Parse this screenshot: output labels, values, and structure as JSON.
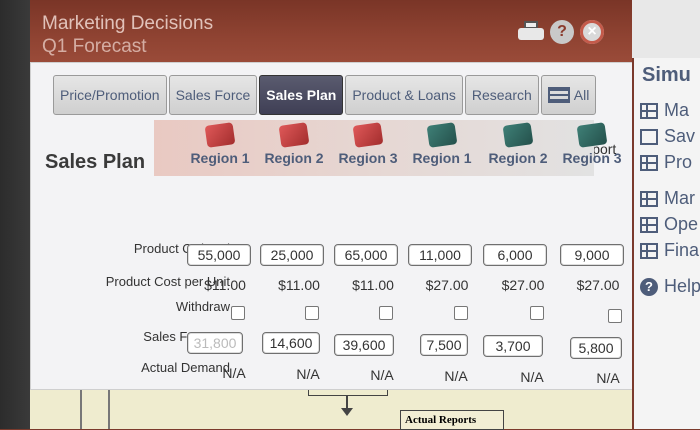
{
  "app": {
    "title": "Marketing Decisions",
    "subtitle": "Q1 Forecast"
  },
  "top_icons": {
    "help": "?",
    "close": "×"
  },
  "tabs": [
    {
      "label": "Price/Promotion",
      "active": false
    },
    {
      "label": "Sales Force",
      "active": false
    },
    {
      "label": "Sales Plan",
      "active": true
    },
    {
      "label": "Product & Loans",
      "active": false
    },
    {
      "label": "Research",
      "active": false
    },
    {
      "label": "All",
      "active": false
    }
  ],
  "page": {
    "title": "Sales Plan",
    "mrkt_report": "MRKT Report"
  },
  "regions": [
    {
      "label": "Region 1",
      "product": "red"
    },
    {
      "label": "Region 2",
      "product": "red"
    },
    {
      "label": "Region 3",
      "product": "red"
    },
    {
      "label": "Region 1",
      "product": "green"
    },
    {
      "label": "Region 2",
      "product": "green"
    },
    {
      "label": "Region 3",
      "product": "green"
    }
  ],
  "rows": {
    "product_ordered": {
      "label": "Product Ordered",
      "values": [
        "55,000",
        "25,000",
        "65,000",
        "11,000",
        "6,000",
        "9,000"
      ]
    },
    "product_cost": {
      "label": "Product Cost per Unit",
      "values": [
        "$11.00",
        "$11.00",
        "$11.00",
        "$27.00",
        "$27.00",
        "$27.00"
      ]
    },
    "withdraw": {
      "label": "Withdraw",
      "checked": [
        false,
        false,
        false,
        false,
        false,
        false
      ]
    },
    "sales_forecast": {
      "label": "Sales Forecast",
      "values": [
        "31,800",
        "14,600",
        "39,600",
        "7,500",
        "3,700",
        "5,800"
      ]
    },
    "actual_demand": {
      "label": "Actual Demand",
      "values": [
        "N/A",
        "N/A",
        "N/A",
        "N/A",
        "N/A",
        "N/A"
      ]
    }
  },
  "below": {
    "actual_reports": "Actual Reports"
  },
  "side_panel": {
    "title": "Simu",
    "items": [
      {
        "label": "Ma",
        "icon": "network-icon"
      },
      {
        "label": "Sav",
        "icon": "save-icon"
      },
      {
        "label": "Pro",
        "icon": "table-icon"
      },
      {
        "label": "Mar",
        "icon": "table-icon"
      },
      {
        "label": "Ope",
        "icon": "table-icon"
      },
      {
        "label": "Fina",
        "icon": "table-icon"
      },
      {
        "label": "Help",
        "icon": "help-icon"
      }
    ]
  },
  "colors": {
    "accent": "#4e5d7a",
    "active_tab": "#4a4b60",
    "brand_bar": "#8f4332"
  }
}
